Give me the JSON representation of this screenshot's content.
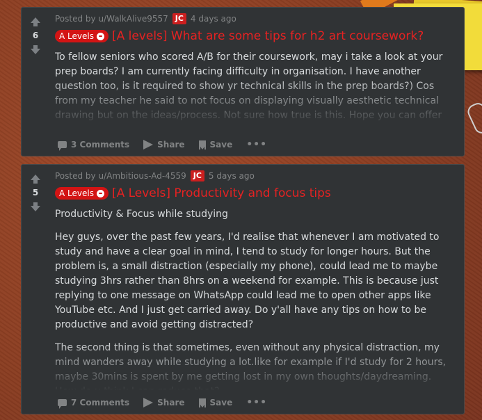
{
  "posts": [
    {
      "score": "6",
      "meta": {
        "posted_by": "Posted by u/WalkAlive9557",
        "user_flair": "JC",
        "time": "4 days ago"
      },
      "flair": "A Levels",
      "title": "[A levels] What are some tips for h2 art coursework?",
      "paragraphs": [
        "To fellow seniors who scored A/B for their coursework, may i take a look at your prep boards? I am currently facing difficulty in organisation. I have another question too, is it required to show yr technical skills in the prep boards?) Cos from my teacher he said to not focus on displaying visually aesthetic technical drawing but on the ideas/process. Not sure how true is this. Hope you can offer some tips as well, thanks!"
      ],
      "actions": {
        "comments": "3 Comments",
        "share": "Share",
        "save": "Save",
        "more": "•••"
      }
    },
    {
      "score": "5",
      "meta": {
        "posted_by": "Posted by u/Ambitious-Ad-4559",
        "user_flair": "JC",
        "time": "5 days ago"
      },
      "flair": "A Levels",
      "title": "[A Levels] Productivity and focus tips",
      "paragraphs": [
        "Productivity & Focus while studying",
        "Hey guys, over the past few years, I'd realise that whenever I am motivated to study and have a clear goal in mind, I tend to study for longer hours. But the problem is, a small distraction (especially my phone), could lead me to maybe studying 3hrs rather than 8hrs on a weekend for example. This is because just replying to one message on WhatsApp could lead me to open other apps like YouTube etc. And I just get carried away. Do y'all have any tips on how to be productive and avoid getting distracted?",
        "The second thing is that sometimes, even without any physical distraction, my mind wanders away while studying a lot.like for example if I'd study for 2 hours, maybe 30mins is spent by me getting lost in my own thoughts/daydreaming. How do u think I can reduce that?"
      ],
      "actions": {
        "comments": "7 Comments",
        "share": "Share",
        "save": "Save",
        "more": "•••"
      }
    }
  ]
}
